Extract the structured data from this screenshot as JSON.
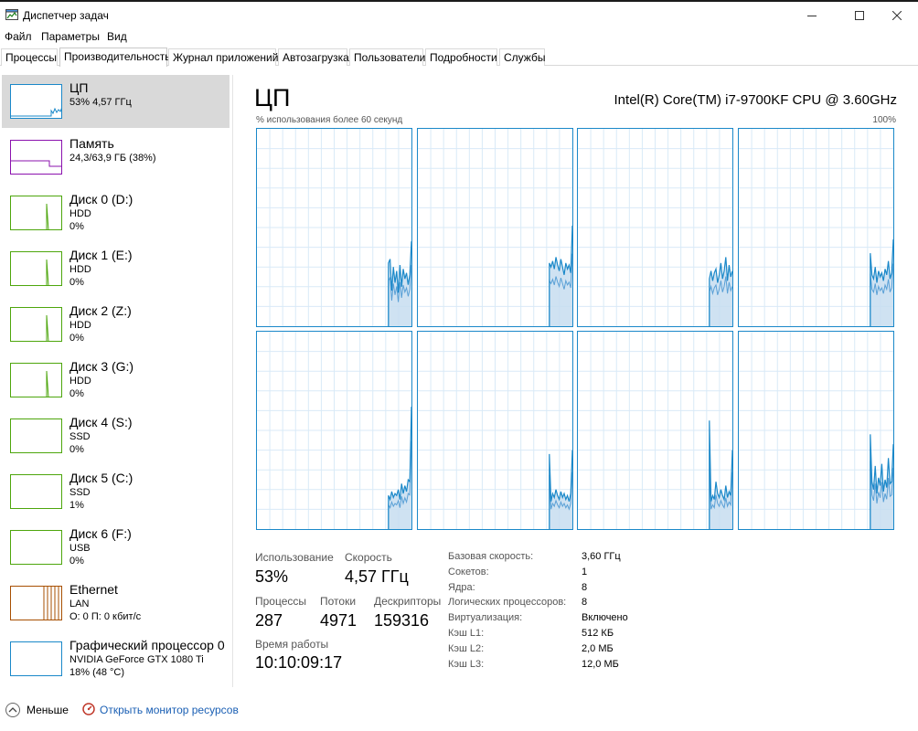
{
  "window": {
    "title": "Диспетчер задач"
  },
  "menu": [
    "Файл",
    "Параметры",
    "Вид"
  ],
  "tabs": [
    "Процессы",
    "Производительность",
    "Журнал приложений",
    "Автозагрузка",
    "Пользователи",
    "Подробности",
    "Службы"
  ],
  "active_tab": "Производительность",
  "sidebar": [
    {
      "name": "ЦП",
      "sub": "53%  4,57 ГГц",
      "sub2": "",
      "color": "#1a88c9",
      "selected": true
    },
    {
      "name": "Память",
      "sub": "24,3/63,9 ГБ (38%)",
      "sub2": "",
      "color": "#8b12ae"
    },
    {
      "name": "Диск 0 (D:)",
      "sub": "HDD",
      "sub2": "0%",
      "color": "#4da60c"
    },
    {
      "name": "Диск 1 (E:)",
      "sub": "HDD",
      "sub2": "0%",
      "color": "#4da60c"
    },
    {
      "name": "Диск 2 (Z:)",
      "sub": "HDD",
      "sub2": "0%",
      "color": "#4da60c"
    },
    {
      "name": "Диск 3 (G:)",
      "sub": "HDD",
      "sub2": "0%",
      "color": "#4da60c"
    },
    {
      "name": "Диск 4 (S:)",
      "sub": "SSD",
      "sub2": "0%",
      "color": "#4da60c"
    },
    {
      "name": "Диск 5 (C:)",
      "sub": "SSD",
      "sub2": "1%",
      "color": "#4da60c"
    },
    {
      "name": "Диск 6 (F:)",
      "sub": "USB",
      "sub2": "0%",
      "color": "#4da60c"
    },
    {
      "name": "Ethernet",
      "sub": "LAN",
      "sub2": "О: 0 П: 0 кбит/с",
      "color": "#a74f01"
    },
    {
      "name": "Графический процессор 0",
      "sub": "NVIDIA GeForce GTX 1080 Ti",
      "sub2": "18%  (48 °C)",
      "color": "#1a88c9"
    }
  ],
  "main": {
    "title": "ЦП",
    "cpu_model": "Intel(R) Core(TM) i7-9700KF CPU @ 3.60GHz",
    "graph_caption": "% использования более 60 секунд",
    "graph_max": "100%",
    "accent_color": "#1a88c9"
  },
  "stats": {
    "usage_label": "Использование",
    "usage_value": "53%",
    "speed_label": "Скорость",
    "speed_value": "4,57 ГГц",
    "processes_label": "Процессы",
    "processes_value": "287",
    "threads_label": "Потоки",
    "threads_value": "4971",
    "handles_label": "Дескрипторы",
    "handles_value": "159316",
    "uptime_label": "Время работы",
    "uptime_value": "10:10:09:17"
  },
  "specs": [
    {
      "label": "Базовая скорость:",
      "value": "3,60 ГГц"
    },
    {
      "label": "Сокетов:",
      "value": "1"
    },
    {
      "label": "Ядра:",
      "value": "8"
    },
    {
      "label": "Логических процессоров:",
      "value": "8"
    },
    {
      "label": "Виртуализация:",
      "value": "Включено"
    },
    {
      "label": "Кэш L1:",
      "value": "512 КБ"
    },
    {
      "label": "Кэш L2:",
      "value": "2,0 МБ"
    },
    {
      "label": "Кэш L3:",
      "value": "12,0 МБ"
    }
  ],
  "footer": {
    "fewer_label": "Меньше",
    "resmon_label": "Открыть монитор ресурсов"
  },
  "core_graphs": [
    [
      0,
      0,
      0,
      0,
      0,
      0,
      0,
      0,
      0,
      0,
      0,
      0,
      0,
      0,
      0,
      0,
      0,
      0,
      0,
      0,
      0,
      0,
      0,
      0,
      0,
      0,
      0,
      0,
      0,
      0,
      0,
      0,
      0,
      0,
      0,
      0,
      0,
      0,
      0,
      0,
      0,
      0,
      0,
      0,
      0,
      0,
      0,
      0,
      0,
      0,
      0,
      0,
      0,
      0,
      0,
      0,
      0,
      0,
      0,
      0,
      0,
      0,
      0,
      0,
      0,
      0,
      0,
      0,
      0,
      0,
      0,
      0,
      0,
      0,
      0,
      0,
      0,
      0,
      0,
      0,
      32,
      34,
      18,
      30,
      22,
      28,
      17,
      31,
      20,
      29,
      24,
      27,
      21,
      26,
      43
    ],
    [
      0,
      0,
      0,
      0,
      0,
      0,
      0,
      0,
      0,
      0,
      0,
      0,
      0,
      0,
      0,
      0,
      0,
      0,
      0,
      0,
      0,
      0,
      0,
      0,
      0,
      0,
      0,
      0,
      0,
      0,
      0,
      0,
      0,
      0,
      0,
      0,
      0,
      0,
      0,
      0,
      0,
      0,
      0,
      0,
      0,
      0,
      0,
      0,
      0,
      0,
      0,
      0,
      0,
      0,
      0,
      0,
      0,
      0,
      0,
      0,
      0,
      0,
      0,
      0,
      0,
      0,
      0,
      0,
      0,
      0,
      0,
      0,
      0,
      0,
      0,
      0,
      0,
      0,
      0,
      0,
      32,
      30,
      33,
      29,
      35,
      31,
      28,
      34,
      30,
      26,
      32,
      29,
      31,
      27,
      51
    ],
    [
      0,
      0,
      0,
      0,
      0,
      0,
      0,
      0,
      0,
      0,
      0,
      0,
      0,
      0,
      0,
      0,
      0,
      0,
      0,
      0,
      0,
      0,
      0,
      0,
      0,
      0,
      0,
      0,
      0,
      0,
      0,
      0,
      0,
      0,
      0,
      0,
      0,
      0,
      0,
      0,
      0,
      0,
      0,
      0,
      0,
      0,
      0,
      0,
      0,
      0,
      0,
      0,
      0,
      0,
      0,
      0,
      0,
      0,
      0,
      0,
      0,
      0,
      0,
      0,
      0,
      0,
      0,
      0,
      0,
      0,
      0,
      0,
      0,
      0,
      0,
      0,
      0,
      0,
      0,
      0,
      24,
      28,
      23,
      27,
      29,
      22,
      26,
      32,
      24,
      28,
      35,
      23,
      31,
      25,
      28
    ],
    [
      0,
      0,
      0,
      0,
      0,
      0,
      0,
      0,
      0,
      0,
      0,
      0,
      0,
      0,
      0,
      0,
      0,
      0,
      0,
      0,
      0,
      0,
      0,
      0,
      0,
      0,
      0,
      0,
      0,
      0,
      0,
      0,
      0,
      0,
      0,
      0,
      0,
      0,
      0,
      0,
      0,
      0,
      0,
      0,
      0,
      0,
      0,
      0,
      0,
      0,
      0,
      0,
      0,
      0,
      0,
      0,
      0,
      0,
      0,
      0,
      0,
      0,
      0,
      0,
      0,
      0,
      0,
      0,
      0,
      0,
      0,
      0,
      0,
      0,
      0,
      0,
      0,
      0,
      0,
      0,
      37,
      26,
      24,
      30,
      22,
      28,
      25,
      27,
      23,
      29,
      26,
      33,
      24,
      27,
      44
    ],
    [
      0,
      0,
      0,
      0,
      0,
      0,
      0,
      0,
      0,
      0,
      0,
      0,
      0,
      0,
      0,
      0,
      0,
      0,
      0,
      0,
      0,
      0,
      0,
      0,
      0,
      0,
      0,
      0,
      0,
      0,
      0,
      0,
      0,
      0,
      0,
      0,
      0,
      0,
      0,
      0,
      0,
      0,
      0,
      0,
      0,
      0,
      0,
      0,
      0,
      0,
      0,
      0,
      0,
      0,
      0,
      0,
      0,
      0,
      0,
      0,
      0,
      0,
      0,
      0,
      0,
      0,
      0,
      0,
      0,
      0,
      0,
      0,
      0,
      0,
      0,
      0,
      0,
      0,
      0,
      0,
      17,
      15,
      19,
      16,
      18,
      17,
      20,
      15,
      23,
      18,
      22,
      19,
      25,
      24,
      62
    ],
    [
      0,
      0,
      0,
      0,
      0,
      0,
      0,
      0,
      0,
      0,
      0,
      0,
      0,
      0,
      0,
      0,
      0,
      0,
      0,
      0,
      0,
      0,
      0,
      0,
      0,
      0,
      0,
      0,
      0,
      0,
      0,
      0,
      0,
      0,
      0,
      0,
      0,
      0,
      0,
      0,
      0,
      0,
      0,
      0,
      0,
      0,
      0,
      0,
      0,
      0,
      0,
      0,
      0,
      0,
      0,
      0,
      0,
      0,
      0,
      0,
      0,
      0,
      0,
      0,
      0,
      0,
      0,
      0,
      0,
      0,
      0,
      0,
      0,
      0,
      0,
      0,
      0,
      0,
      0,
      0,
      38,
      14,
      18,
      16,
      20,
      17,
      15,
      19,
      16,
      18,
      15,
      17,
      14,
      18,
      40
    ],
    [
      0,
      0,
      0,
      0,
      0,
      0,
      0,
      0,
      0,
      0,
      0,
      0,
      0,
      0,
      0,
      0,
      0,
      0,
      0,
      0,
      0,
      0,
      0,
      0,
      0,
      0,
      0,
      0,
      0,
      0,
      0,
      0,
      0,
      0,
      0,
      0,
      0,
      0,
      0,
      0,
      0,
      0,
      0,
      0,
      0,
      0,
      0,
      0,
      0,
      0,
      0,
      0,
      0,
      0,
      0,
      0,
      0,
      0,
      0,
      0,
      0,
      0,
      0,
      0,
      0,
      0,
      0,
      0,
      0,
      0,
      0,
      0,
      0,
      0,
      0,
      0,
      0,
      0,
      0,
      0,
      55,
      14,
      17,
      15,
      24,
      18,
      16,
      20,
      17,
      15,
      22,
      16,
      19,
      17,
      40
    ],
    [
      0,
      0,
      0,
      0,
      0,
      0,
      0,
      0,
      0,
      0,
      0,
      0,
      0,
      0,
      0,
      0,
      0,
      0,
      0,
      0,
      0,
      0,
      0,
      0,
      0,
      0,
      0,
      0,
      0,
      0,
      0,
      0,
      0,
      0,
      0,
      0,
      0,
      0,
      0,
      0,
      0,
      0,
      0,
      0,
      0,
      0,
      0,
      0,
      0,
      0,
      0,
      0,
      0,
      0,
      0,
      0,
      0,
      0,
      0,
      0,
      0,
      0,
      0,
      0,
      0,
      0,
      0,
      0,
      0,
      0,
      0,
      0,
      0,
      0,
      0,
      0,
      0,
      0,
      0,
      0,
      48,
      24,
      20,
      32,
      18,
      26,
      22,
      33,
      19,
      25,
      21,
      36,
      23,
      24,
      43
    ]
  ]
}
